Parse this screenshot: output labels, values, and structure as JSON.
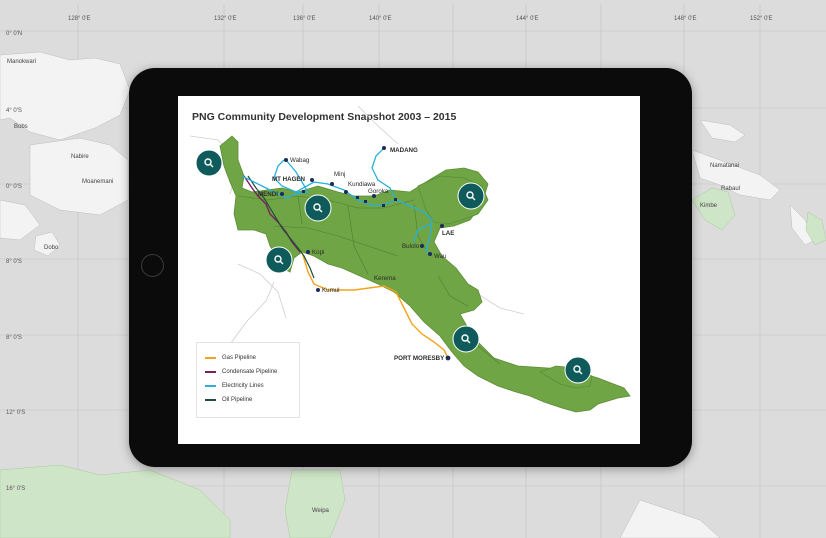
{
  "map": {
    "title": "PNG Community Development Snapshot 2003 – 2015",
    "background": {
      "longitude_labels": [
        "128° 0'E",
        "132° 0'E",
        "136° 0'E",
        "140° 0'E",
        "144° 0'E",
        "148° 0'E",
        "152° 0'E"
      ],
      "latitude_labels": [
        "0° 0'N",
        "4° 0'S",
        "0° 0'S",
        "8° 0'S",
        "8° 0'S",
        "12° 0'S",
        "16° 0'S"
      ],
      "places": [
        "Manokwari",
        "Bobs",
        "Nabire",
        "Moanemani",
        "Dobo",
        "Namatanai",
        "Rabaul",
        "Kimbe",
        "Weipa"
      ]
    },
    "places": {
      "wabag": "Wabag",
      "mt_hagen": "MT HAGEN",
      "minj": "Minj",
      "kundiawa": "Kundiawa",
      "goroka": "Goroka",
      "madang": "MADANG",
      "mendi": "MENDI",
      "lae": "LAE",
      "bulolo": "Bulolo",
      "wau": "Wau",
      "kopi": "Kopi",
      "kumul": "Kumul",
      "kerema": "Kerema",
      "port_moresby": "PORT MORESBY"
    },
    "legend": [
      {
        "label": "Gas Pipeline",
        "color": "#f5a31a"
      },
      {
        "label": "Condensate Pipeline",
        "color": "#7b1f5e"
      },
      {
        "label": "Electricity Lines",
        "color": "#2bb0d9"
      },
      {
        "label": "Oil Pipeline",
        "color": "#1f4d3a"
      }
    ],
    "colors": {
      "land": "#6fa544",
      "pin": "#0f5b5b",
      "device": "#0b0b0b"
    },
    "search_pins": [
      "search-icon",
      "search-icon",
      "search-icon",
      "search-icon",
      "search-icon",
      "search-icon"
    ]
  }
}
